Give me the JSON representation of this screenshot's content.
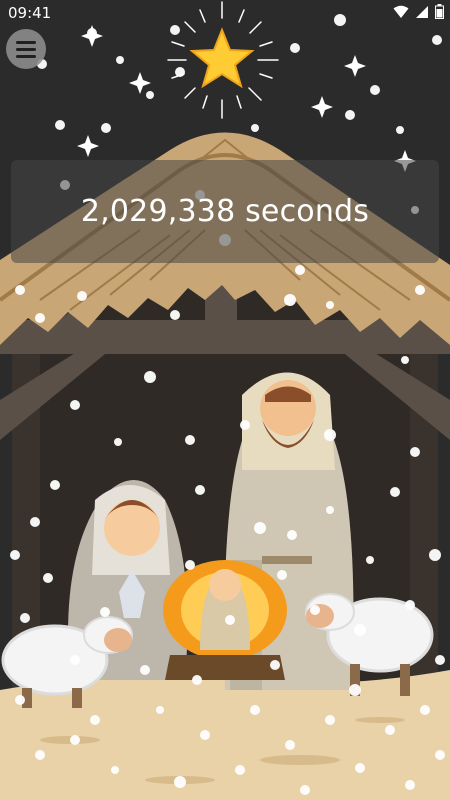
{
  "status_bar": {
    "time": "09:41",
    "icons": [
      "wifi-icon",
      "signal-icon",
      "battery-icon"
    ]
  },
  "menu": {
    "icon": "hamburger-menu-icon"
  },
  "counter": {
    "text": "2,029,338 seconds"
  },
  "scene": {
    "description_icons": [
      "star-icon",
      "manger-icon",
      "mary-figure",
      "joseph-figure",
      "baby-jesus-figure",
      "sheep-left",
      "sheep-right"
    ],
    "colors": {
      "sky": "#2b2b2b",
      "roof": "#c9a676",
      "roof_dark": "#a07a48",
      "beam": "#5a5048",
      "ground": "#e9d1a8",
      "star": "#ffcc33",
      "halo": "#f59b1b",
      "counter_bg": "#464646"
    }
  }
}
